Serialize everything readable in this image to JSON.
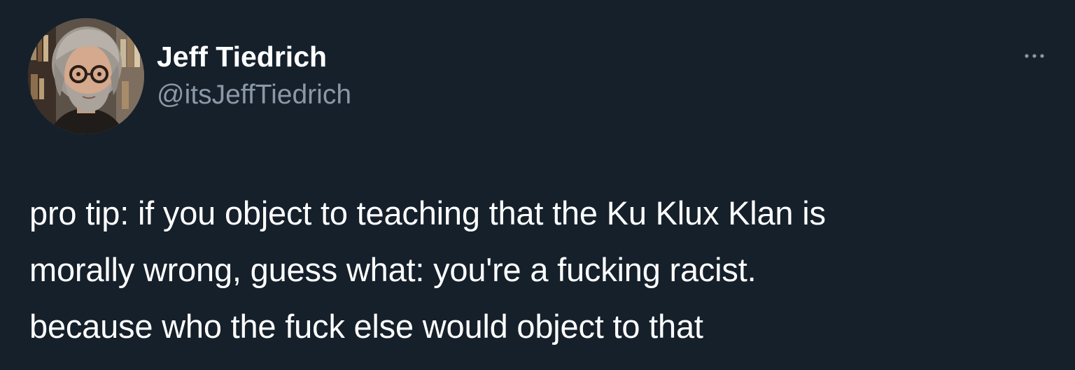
{
  "background_color": "#15202b",
  "author": {
    "display_name": "Jeff Tiedrich",
    "handle": "@itsJeffTiedrich",
    "avatar_icon": "profile-photo"
  },
  "more_icon": "more-options-ellipsis",
  "tweet": {
    "lines": [
      "pro tip: if you object to teaching that the Ku Klux Klan is",
      "morally wrong, guess what: you're a fucking racist.",
      "because who the fuck else would object to that"
    ]
  },
  "colors": {
    "text_primary": "#ffffff",
    "text_secondary": "#8b98a5"
  }
}
